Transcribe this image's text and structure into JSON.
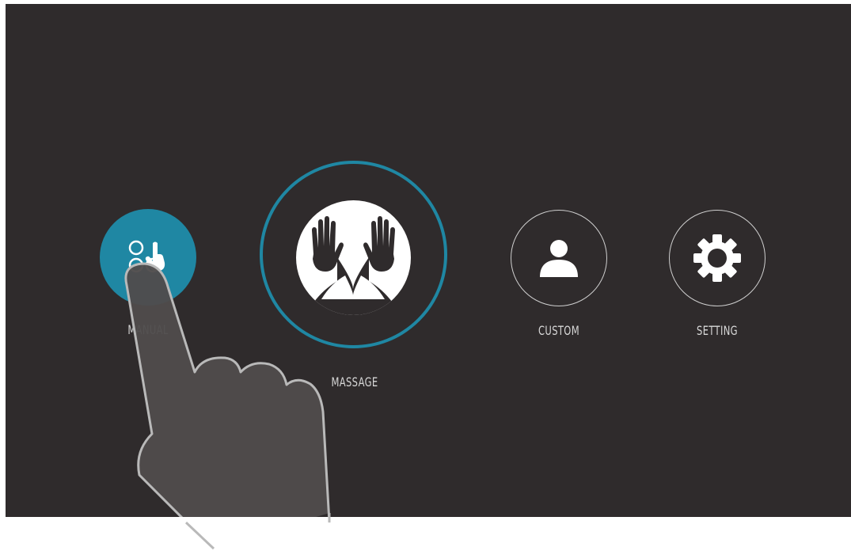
{
  "menu": {
    "items": [
      {
        "id": "manual",
        "label": "MANUAL",
        "icon": "touch-grid-icon",
        "selected": true
      },
      {
        "id": "massage",
        "label": "MASSAGE",
        "icon": "hands-icon"
      },
      {
        "id": "custom",
        "label": "CUSTOM",
        "icon": "user-icon"
      },
      {
        "id": "setting",
        "label": "SETTING",
        "icon": "gear-icon"
      }
    ]
  },
  "colors": {
    "background": "#2f2b2c",
    "accent": "#1f87a3",
    "text": "#d9d9d9"
  }
}
